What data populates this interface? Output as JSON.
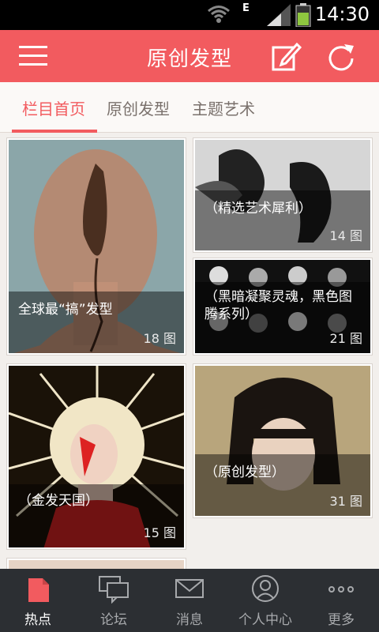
{
  "status_bar": {
    "time": "14:30",
    "network_label": "E"
  },
  "app_bar": {
    "title": "原创发型"
  },
  "tabs": [
    {
      "label": "栏目首页",
      "active": true
    },
    {
      "label": "原创发型",
      "active": false
    },
    {
      "label": "主题艺术",
      "active": false
    }
  ],
  "cards": [
    {
      "title": "全球最“搞”发型",
      "count": "18 图"
    },
    {
      "title": "（精选艺术犀利）",
      "count": "14 图"
    },
    {
      "title": "（黑暗凝聚灵魂，黑色图腾系列）",
      "count": "21 图"
    },
    {
      "title": "（金发天国）",
      "count": "15 图"
    },
    {
      "title": "（原创发型）",
      "count": "31 图"
    }
  ],
  "bottom_nav": [
    {
      "label": "热点",
      "icon": "hot-icon",
      "active": true
    },
    {
      "label": "论坛",
      "icon": "forum-icon",
      "active": false
    },
    {
      "label": "消息",
      "icon": "message-icon",
      "active": false
    },
    {
      "label": "个人中心",
      "icon": "user-icon",
      "active": false
    },
    {
      "label": "更多",
      "icon": "more-icon",
      "active": false
    }
  ],
  "colors": {
    "accent": "#f25b5f",
    "nav_background": "#2c2f33"
  }
}
